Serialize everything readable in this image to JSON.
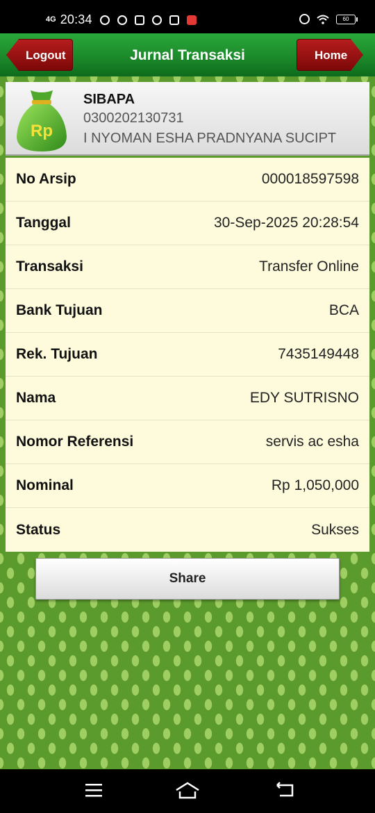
{
  "status_bar": {
    "network": "4G",
    "time": "20:34",
    "battery": "60"
  },
  "header": {
    "title": "Jurnal Transaksi",
    "logout_label": "Logout",
    "home_label": "Home"
  },
  "account": {
    "icon_text": "Rp",
    "app_name": "SIBAPA",
    "account_number": "0300202130731",
    "holder_name": "I NYOMAN ESHA PRADNYANA SUCIPT"
  },
  "details": [
    {
      "label": "No Arsip",
      "value": "000018597598"
    },
    {
      "label": "Tanggal",
      "value": "30-Sep-2025 20:28:54"
    },
    {
      "label": "Transaksi",
      "value": "Transfer Online"
    },
    {
      "label": "Bank Tujuan",
      "value": "BCA"
    },
    {
      "label": "Rek. Tujuan",
      "value": "7435149448"
    },
    {
      "label": "Nama",
      "value": "EDY SUTRISNO"
    },
    {
      "label": "Nomor Referensi",
      "value": "servis ac esha"
    },
    {
      "label": "Nominal",
      "value": "Rp 1,050,000"
    },
    {
      "label": "Status",
      "value": "Sukses"
    }
  ],
  "share_label": "Share",
  "icons": {
    "status": [
      "whatsapp-icon",
      "game-icon",
      "instagram-icon",
      "app-icon",
      "mail-icon",
      "wps-icon",
      "alarm-icon",
      "wifi-icon",
      "battery-icon"
    ],
    "nav": [
      "menu-icon",
      "home-icon",
      "back-icon"
    ]
  },
  "colors": {
    "titlebar_green": "#1c8a2b",
    "nav_button_red": "#9e1212",
    "table_background": "#fdfbdc",
    "pattern_green": "#5b9a2c"
  }
}
